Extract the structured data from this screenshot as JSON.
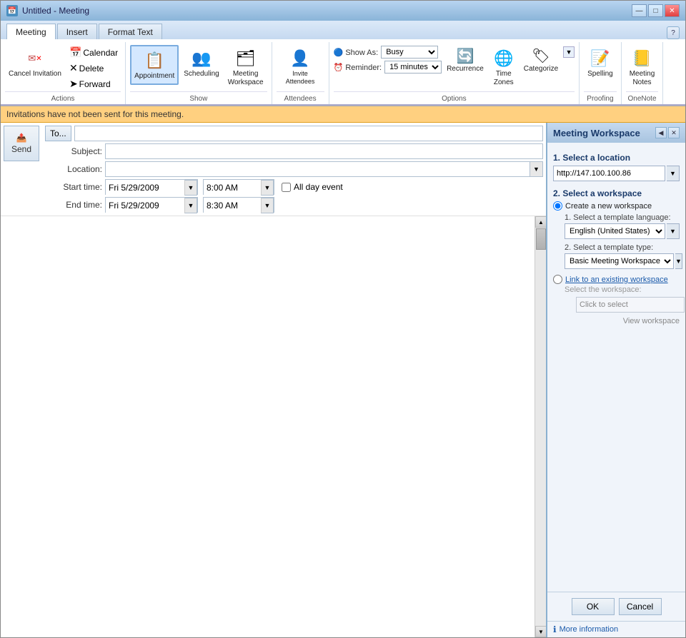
{
  "window": {
    "title": "Untitled - Meeting",
    "minimize_label": "—",
    "maximize_label": "□",
    "close_label": "✕"
  },
  "tabs": [
    {
      "id": "meeting",
      "label": "Meeting",
      "active": true
    },
    {
      "id": "insert",
      "label": "Insert"
    },
    {
      "id": "format_text",
      "label": "Format Text"
    }
  ],
  "ribbon": {
    "groups": [
      {
        "name": "Actions",
        "items": [
          {
            "id": "cancel-invitation",
            "label": "Cancel\nInvitation",
            "type": "large"
          },
          {
            "id": "calendar",
            "label": "Calendar",
            "type": "small"
          },
          {
            "id": "delete",
            "label": "Delete",
            "type": "small"
          },
          {
            "id": "forward",
            "label": "Forward",
            "type": "small"
          }
        ]
      },
      {
        "name": "Show",
        "items": [
          {
            "id": "appointment",
            "label": "Appointment",
            "type": "large"
          },
          {
            "id": "scheduling",
            "label": "Scheduling",
            "type": "large"
          },
          {
            "id": "meeting-workspace",
            "label": "Meeting\nWorkspace",
            "type": "large"
          }
        ]
      },
      {
        "name": "Attendees",
        "items": []
      },
      {
        "name": "Options",
        "items": [
          {
            "id": "show-as",
            "label": "Show As:",
            "value": "Busy"
          },
          {
            "id": "reminder",
            "label": "Reminder:",
            "value": "15 minutes"
          },
          {
            "id": "recurrence",
            "label": "Recurrence",
            "type": "large"
          },
          {
            "id": "time-zones",
            "label": "Time\nZones",
            "type": "large"
          },
          {
            "id": "categorize",
            "label": "Categorize",
            "type": "large"
          }
        ]
      },
      {
        "name": "Proofing",
        "items": [
          {
            "id": "spelling",
            "label": "Spelling",
            "type": "large"
          }
        ]
      },
      {
        "name": "OneNote",
        "items": [
          {
            "id": "meeting-notes",
            "label": "Meeting\nNotes",
            "type": "large"
          }
        ]
      }
    ]
  },
  "info_bar": {
    "message": "Invitations have not been sent for this meeting."
  },
  "form": {
    "to_button": "To...",
    "to_value": "",
    "subject_label": "Subject:",
    "subject_value": "",
    "location_label": "Location:",
    "location_value": "",
    "start_time_label": "Start time:",
    "start_date_value": "Fri 5/29/2009",
    "start_time_value": "8:00 AM",
    "end_time_label": "End time:",
    "end_date_value": "Fri 5/29/2009",
    "end_time_value": "8:30 AM",
    "all_day_label": "All day event",
    "send_label": "Send"
  },
  "sidebar": {
    "title": "Meeting Workspace",
    "section1_label": "1. Select a location",
    "url_value": "http://147.100.100.86",
    "section2_label": "2. Select a workspace",
    "create_label": "Create a new workspace",
    "template_lang_label": "1. Select a template language:",
    "template_lang_value": "English (United States)",
    "template_type_label": "2. Select a template type:",
    "template_type_value": "Basic Meeting Workspace",
    "link_label": "Link to an existing workspace",
    "select_workspace_label": "Select the workspace:",
    "click_to_select_value": "Click to select",
    "view_workspace_label": "View workspace",
    "ok_label": "OK",
    "cancel_label": "Cancel",
    "more_info_label": "More information"
  }
}
